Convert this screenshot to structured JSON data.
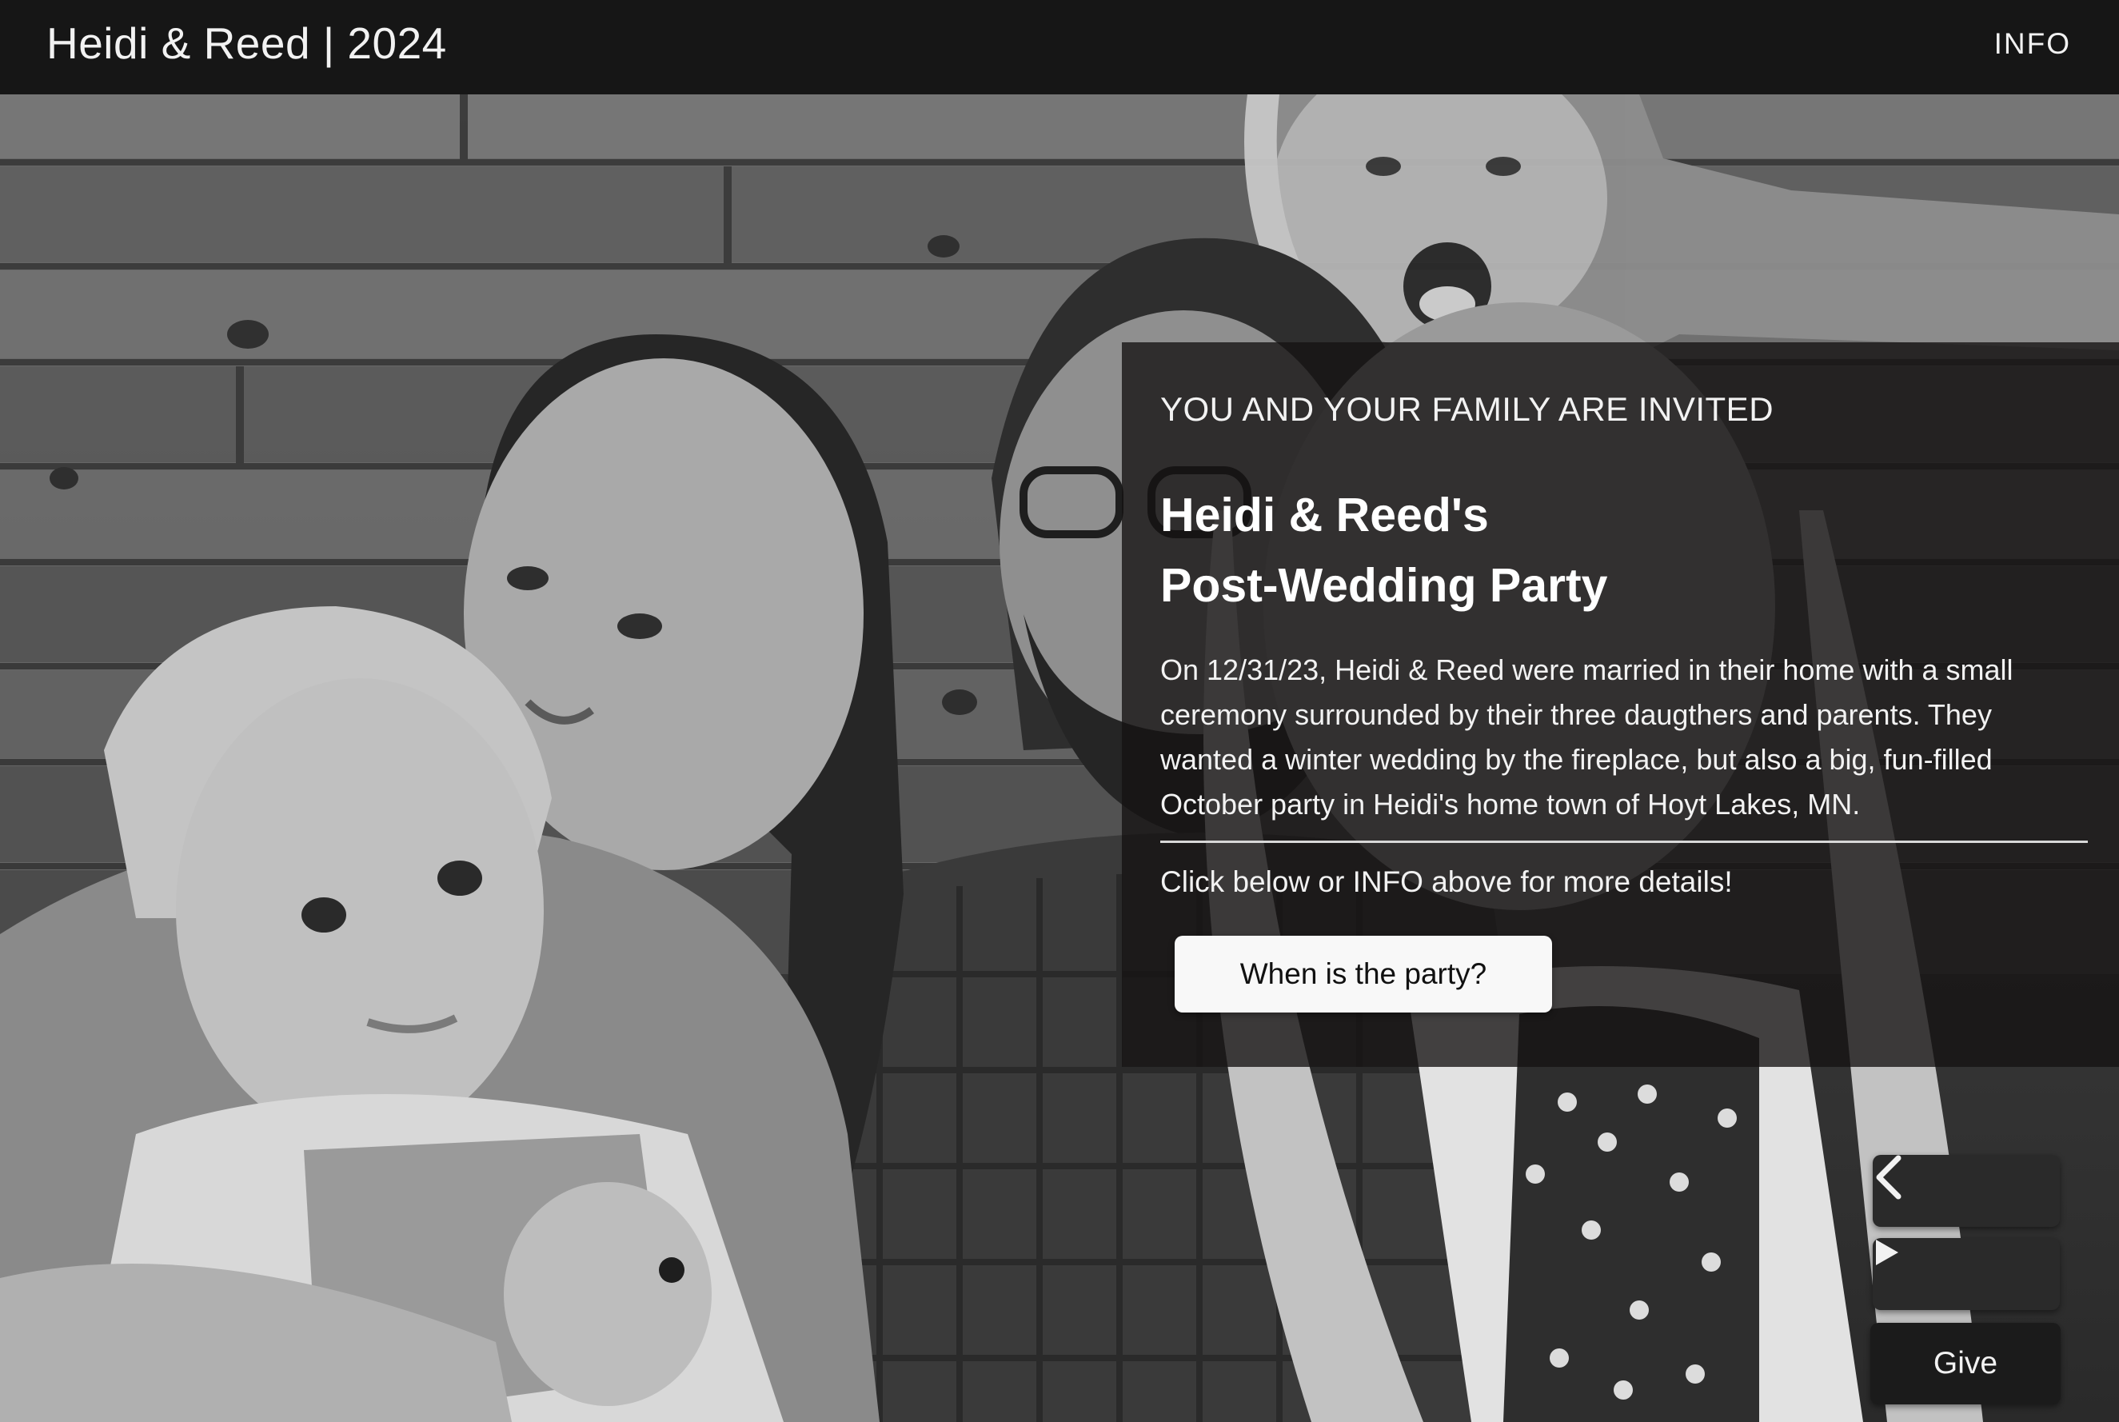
{
  "header": {
    "site_title": "Heidi & Reed | 2024",
    "nav_info": "INFO"
  },
  "hero": {
    "photo_description_icon": "family-photo"
  },
  "card": {
    "eyebrow": "YOU AND YOUR FAMILY ARE INVITED",
    "headline_line1": "Heidi & Reed's",
    "headline_line2": "Post-Wedding Party",
    "body": "On 12/31/23, Heidi & Reed were married in their home with a small ceremony surrounded by their three daugthers and parents. They wanted a winter wedding by the fireplace, but also a big, fun-filled October party in Heidi's home town of Hoyt Lakes, MN.",
    "prompt": "Click below or INFO above for more details!",
    "cta_label": "When is the party?"
  },
  "controls": {
    "prev_icon": "chevron-left-icon",
    "play_icon": "play-icon",
    "give_label": "Give"
  }
}
